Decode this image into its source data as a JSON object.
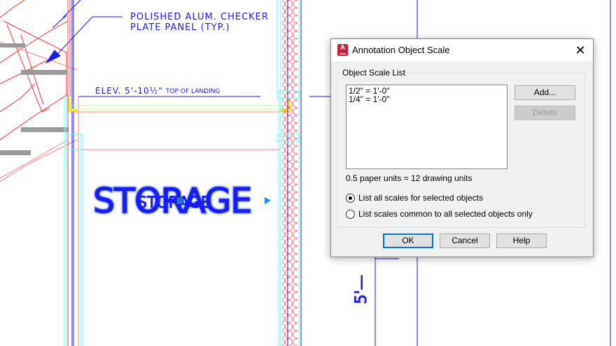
{
  "drawing": {
    "note_line1": "POLISHED ALUM. CHECKER",
    "note_line2": "PLATE PANEL (TYP.)",
    "elevation_label": "ELEV. 5'-10½\"",
    "elevation_suffix": "TOP OF LANDING",
    "room_label_large": "STORAGE",
    "room_label_small": "STORAGE",
    "dimension_text": "5'—"
  },
  "dialog": {
    "title": "Annotation Object Scale",
    "icon": "autocad-icon",
    "close_icon": "close-icon",
    "group_label": "Object Scale List",
    "scales": [
      "1/2\" = 1'-0\"",
      "1/4\" = 1'-0\""
    ],
    "add_label": "Add...",
    "delete_label": "Delete",
    "status_text": "0.5 paper units = 12 drawing units",
    "radio_all": "List all scales for selected objects",
    "radio_common": "List scales common to all selected objects only",
    "radio_selected": "all",
    "ok_label": "OK",
    "cancel_label": "Cancel",
    "help_label": "Help",
    "accent": "#0078d7"
  }
}
